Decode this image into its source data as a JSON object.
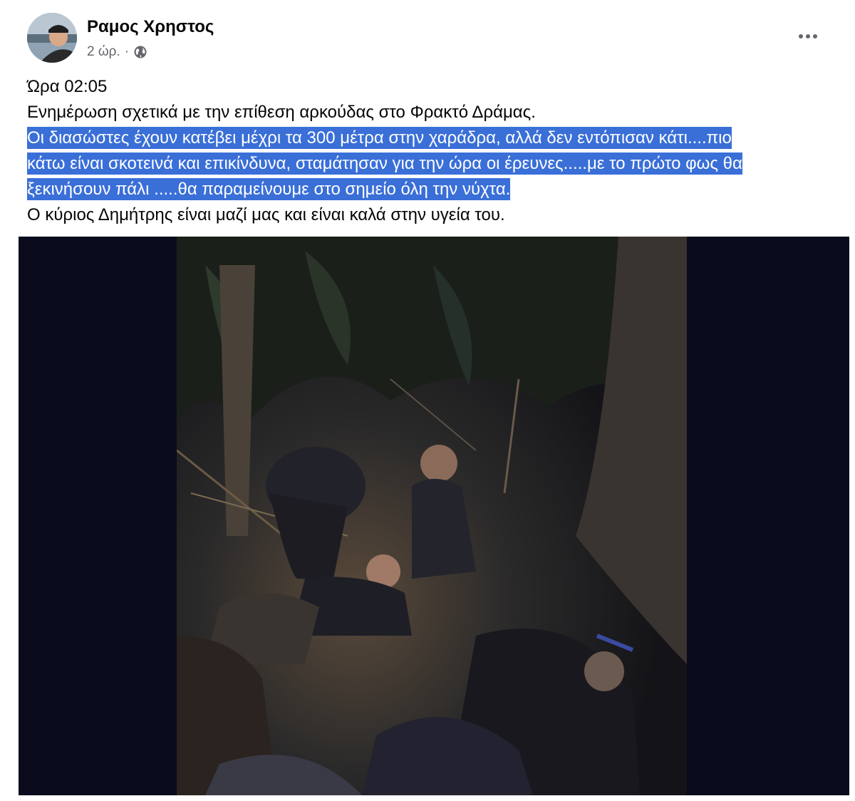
{
  "post": {
    "author": "Ραμος Χρηστος",
    "time": "2 ώρ.",
    "separator": "·",
    "audience_icon": "globe-icon",
    "more_icon": "more-options-icon"
  },
  "content": {
    "line1": "Ώρα 02:05",
    "line2": "Ενημέρωση σχετικά με την επίθεση αρκούδας στο Φρακτό Δράμας.",
    "highlighted_1": "Οι διασώστες έχουν κατέβει μέχρι τα 300 μέτρα στην χαράδρα, αλλά δεν εντόπισαν κάτι....πιο",
    "highlighted_2": "κάτω είναι σκοτεινά και επικίνδυνα, σταμάτησαν για την ώρα οι έρευνες.....με το πρώτο φως θα",
    "highlighted_3": "ξεκινήσουν πάλι .....θα παραμείνουμε στο σημείο όλη την νύχτα.",
    "line_last": "Ο κύριος Δημήτρης είναι μαζί μας και είναι καλά στην υγεία του."
  },
  "colors": {
    "highlight": "#3a6fd8",
    "media_background": "#0b0b1e",
    "secondary_text": "#65676b"
  }
}
